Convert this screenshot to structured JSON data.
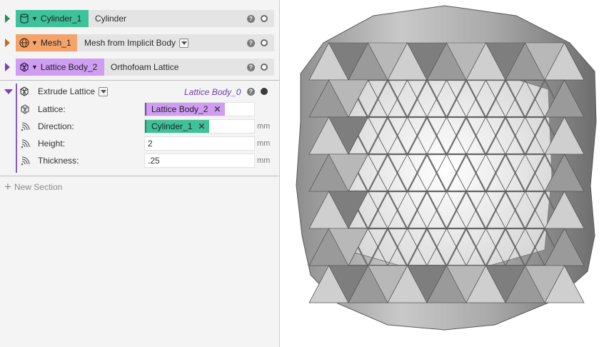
{
  "colors": {
    "cylinder": "#3ec29a",
    "mesh": "#f4a46a",
    "lattice": "#cf9df2",
    "extrude_rail": "#8a5cc4"
  },
  "nodes": [
    {
      "name": "Cylinder_1",
      "description": "Cylinder",
      "icon": "cylinder-icon",
      "color": "#3ec29a"
    },
    {
      "name": "Mesh_1",
      "description": "Mesh from Implicit Body",
      "icon": "globe-icon",
      "color": "#f4a46a"
    },
    {
      "name": "Lattice Body_2",
      "description": "Orthofoam Lattice",
      "icon": "lattice-cube-icon",
      "color": "#cf9df2"
    }
  ],
  "extrude": {
    "title": "Extrude Lattice",
    "output": "Lattice Body_0",
    "params": [
      {
        "label": "Lattice:",
        "value": "Lattice Body_2",
        "unit": "",
        "icon": "lattice-cube-icon"
      },
      {
        "label": "Direction:",
        "value": "Cylinder_1",
        "unit": "mm",
        "icon": "signal-icon"
      },
      {
        "label": "Height:",
        "value": "2",
        "unit": "mm",
        "icon": "signal-icon"
      },
      {
        "label": "Thickness:",
        "value": ".25",
        "unit": "mm",
        "icon": "signal-icon"
      }
    ]
  },
  "new_section": "New Section",
  "help_glyph": "?",
  "remove_glyph": "✕"
}
